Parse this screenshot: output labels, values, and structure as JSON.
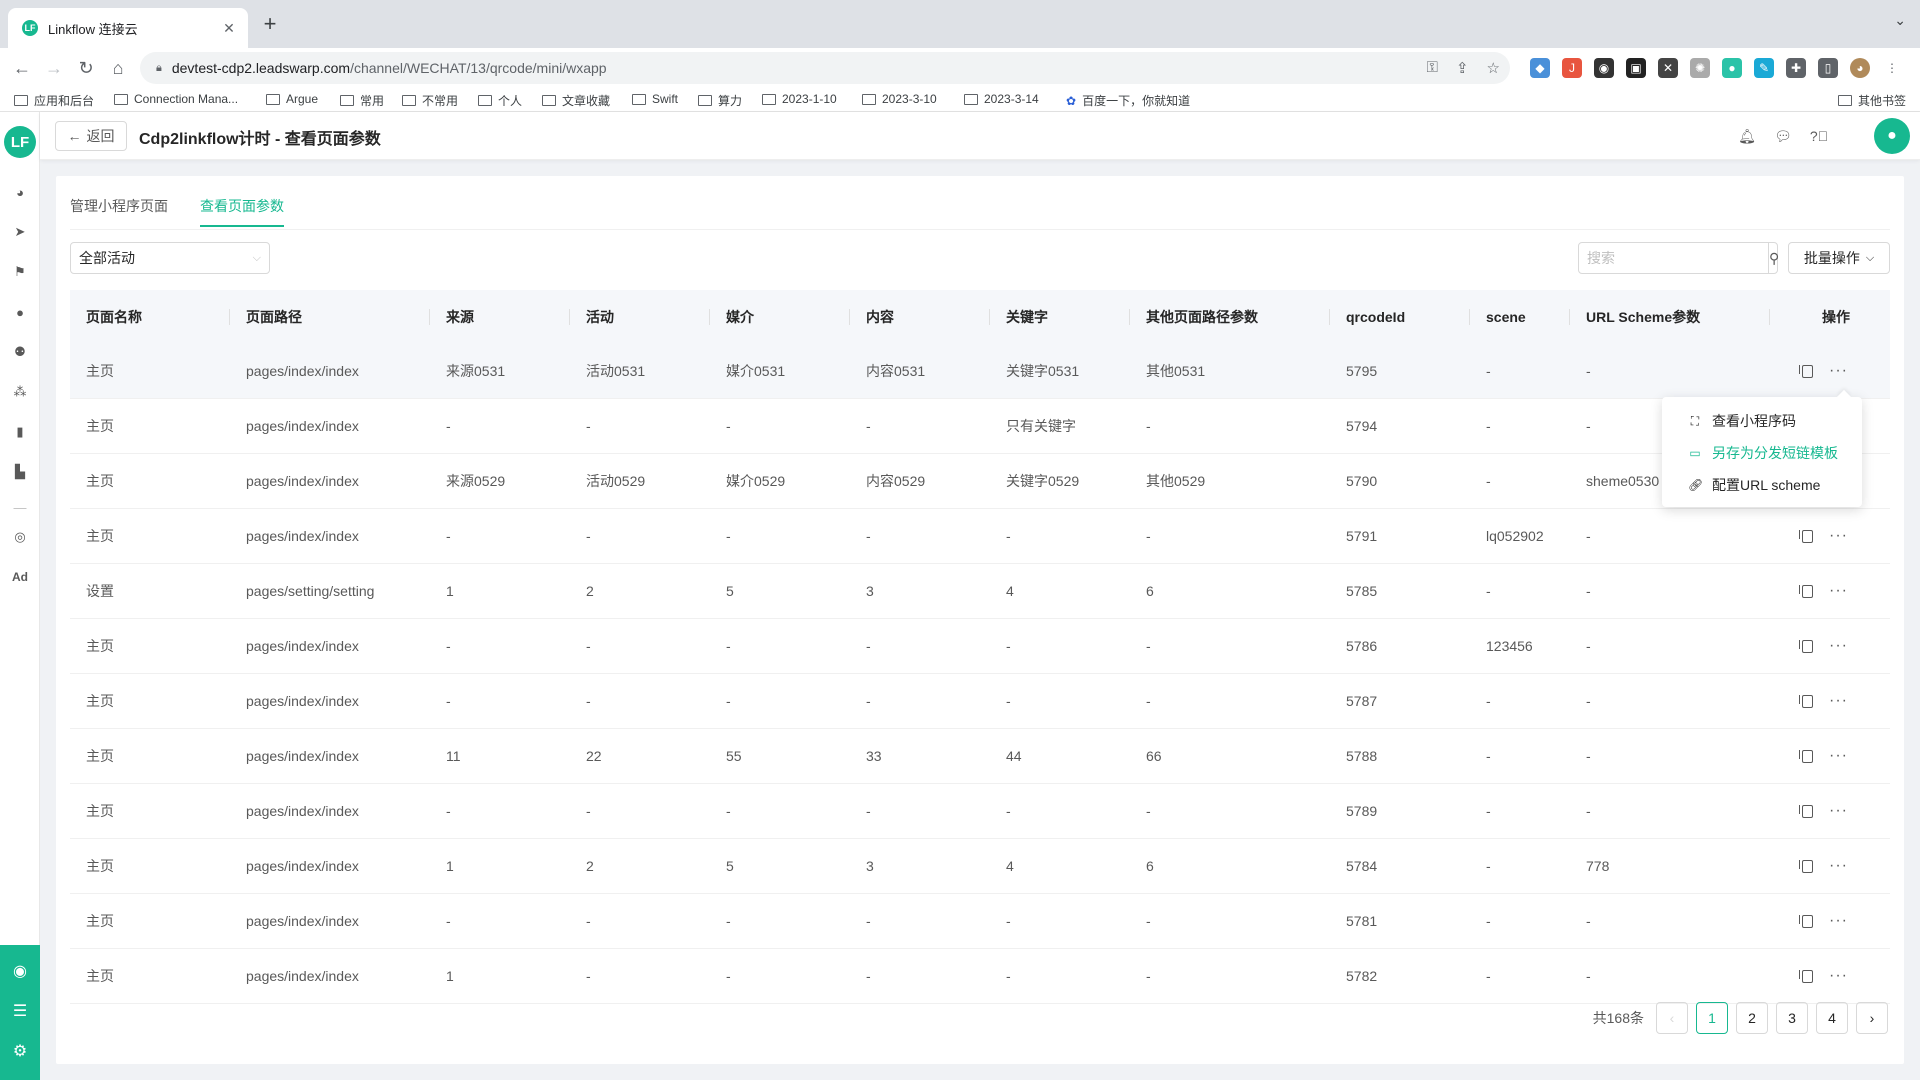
{
  "browser": {
    "tab_title": "Linkflow 连接云",
    "url_host": "devtest-cdp2.leadswarp.com",
    "url_path": "/channel/WECHAT/13/qrcode/mini/wxapp",
    "bookmarks": [
      "应用和后台",
      "Connection Mana...",
      "Argue",
      "常用",
      "不常用",
      "个人",
      "文章收藏",
      "Swift",
      "算力",
      "2023-1-10",
      "2023-3-10",
      "2023-3-14",
      "百度一下，你就知道"
    ],
    "other_bookmarks": "其他书签"
  },
  "header": {
    "back_label": "返回",
    "title": "Cdp2linkflow计时 - 查看页面参数"
  },
  "tabs": [
    "管理小程序页面",
    "查看页面参数"
  ],
  "filter": {
    "activity_select": "全部活动",
    "search_placeholder": "搜索",
    "batch_label": "批量操作"
  },
  "table": {
    "columns": [
      "页面名称",
      "页面路径",
      "来源",
      "活动",
      "媒介",
      "内容",
      "关键字",
      "其他页面路径参数",
      "qrcodeId",
      "scene",
      "URL Scheme参数",
      "操作"
    ],
    "rows": [
      [
        "主页",
        "pages/index/index",
        "来源0531",
        "活动0531",
        "媒介0531",
        "内容0531",
        "关键字0531",
        "其他0531",
        "5795",
        "-",
        "-"
      ],
      [
        "主页",
        "pages/index/index",
        "-",
        "-",
        "-",
        "-",
        "只有关键字",
        "-",
        "5794",
        "-",
        "-"
      ],
      [
        "主页",
        "pages/index/index",
        "来源0529",
        "活动0529",
        "媒介0529",
        "内容0529",
        "关键字0529",
        "其他0529",
        "5790",
        "-",
        "sheme0530"
      ],
      [
        "主页",
        "pages/index/index",
        "-",
        "-",
        "-",
        "-",
        "-",
        "-",
        "5791",
        "lq052902",
        "-"
      ],
      [
        "设置",
        "pages/setting/setting",
        "1",
        "2",
        "5",
        "3",
        "4",
        "6",
        "5785",
        "-",
        "-"
      ],
      [
        "主页",
        "pages/index/index",
        "-",
        "-",
        "-",
        "-",
        "-",
        "-",
        "5786",
        "123456",
        "-"
      ],
      [
        "主页",
        "pages/index/index",
        "-",
        "-",
        "-",
        "-",
        "-",
        "-",
        "5787",
        "-",
        "-"
      ],
      [
        "主页",
        "pages/index/index",
        "11",
        "22",
        "55",
        "33",
        "44",
        "66",
        "5788",
        "-",
        "-"
      ],
      [
        "主页",
        "pages/index/index",
        "-",
        "-",
        "-",
        "-",
        "-",
        "-",
        "5789",
        "-",
        "-"
      ],
      [
        "主页",
        "pages/index/index",
        "1",
        "2",
        "5",
        "3",
        "4",
        "6",
        "5784",
        "-",
        "778"
      ],
      [
        "主页",
        "pages/index/index",
        "-",
        "-",
        "-",
        "-",
        "-",
        "-",
        "5781",
        "-",
        "-"
      ],
      [
        "主页",
        "pages/index/index",
        "1",
        "-",
        "-",
        "-",
        "-",
        "-",
        "5782",
        "-",
        "-"
      ]
    ]
  },
  "dropdown": {
    "items": [
      "查看小程序码",
      "另存为分发短链模板",
      "配置URL scheme"
    ]
  },
  "pagination": {
    "total": "共168条",
    "pages": [
      "1",
      "2",
      "3",
      "4"
    ],
    "current": "1"
  },
  "colors": {
    "accent": "#17b890"
  }
}
